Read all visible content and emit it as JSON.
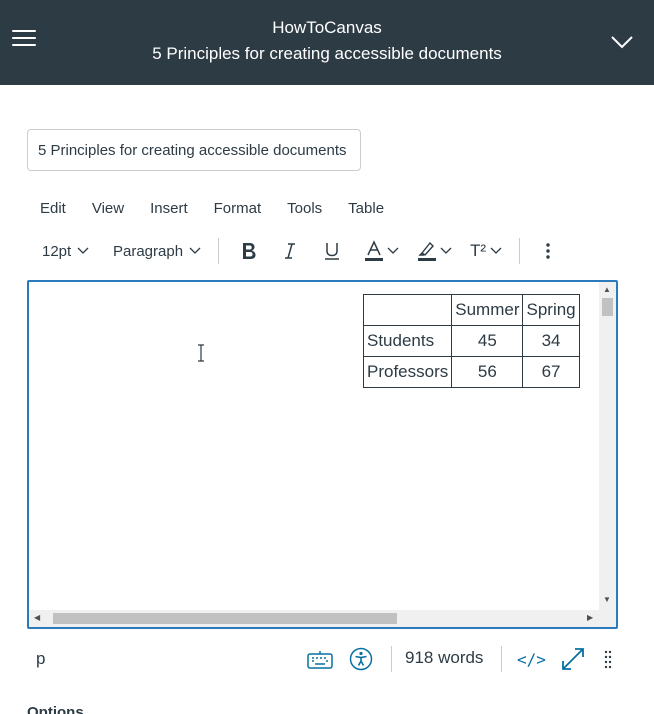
{
  "header": {
    "title": "HowToCanvas",
    "subtitle": "5 Principles for creating accessible documents",
    "menu_icon": "hamburger-icon",
    "expand_icon": "chevron-down-icon"
  },
  "title_field": {
    "value": "5 Principles for creating accessible documents"
  },
  "menubar": [
    "Edit",
    "View",
    "Insert",
    "Format",
    "Tools",
    "Table"
  ],
  "toolbar": {
    "font_size": "12pt",
    "block_format": "Paragraph",
    "superscript_label": "T²"
  },
  "table": {
    "header": [
      "",
      "Summer",
      "Spring"
    ],
    "rows": [
      [
        "Students",
        "45",
        "34"
      ],
      [
        "Professors",
        "56",
        "67"
      ]
    ]
  },
  "statusbar": {
    "path": "p",
    "word_count": "918 words",
    "html_editor_label": "</>"
  },
  "options_label": "Options",
  "colors": {
    "header_bg": "#2d3b45",
    "focus_border": "#2b7abc",
    "accent": "#0770a3"
  }
}
